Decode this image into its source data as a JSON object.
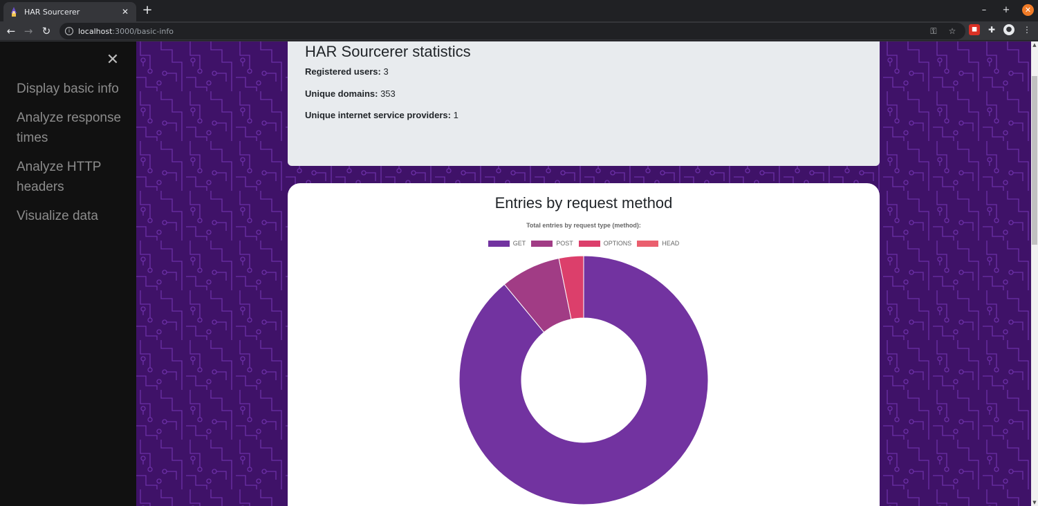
{
  "browser": {
    "tab_title": "HAR Sourcerer",
    "url_host": "localhost",
    "url_path": ":3000/basic-info",
    "new_tab_symbol": "+",
    "tab_close_symbol": "✕"
  },
  "sidebar": {
    "close_symbol": "✕",
    "items": [
      {
        "label": "Display basic info"
      },
      {
        "label": "Analyze response times"
      },
      {
        "label": "Analyze HTTP headers"
      },
      {
        "label": "Visualize data"
      }
    ]
  },
  "stats": {
    "title": "HAR Sourcerer statistics",
    "rows": [
      {
        "label": "Registered users:",
        "value": "3"
      },
      {
        "label": "Unique domains:",
        "value": "353"
      },
      {
        "label": "Unique internet service providers:",
        "value": "1"
      }
    ]
  },
  "chart_section": {
    "heading": "Entries by request method"
  },
  "chart_data": {
    "type": "pie",
    "subtitle": "Total entries by request type (method):",
    "legend_position": "top",
    "categories": [
      "GET",
      "POST",
      "OPTIONS",
      "HEAD"
    ],
    "values": [
      89,
      7.8,
      3.2,
      0
    ],
    "colors": [
      "#7233a0",
      "#a13c85",
      "#dc3f6b",
      "#ea5f6e"
    ],
    "donut": true
  },
  "colors": {
    "sidebar_bg": "#111111",
    "page_bg": "#3f1268",
    "stats_card_bg": "#e8ebee"
  }
}
